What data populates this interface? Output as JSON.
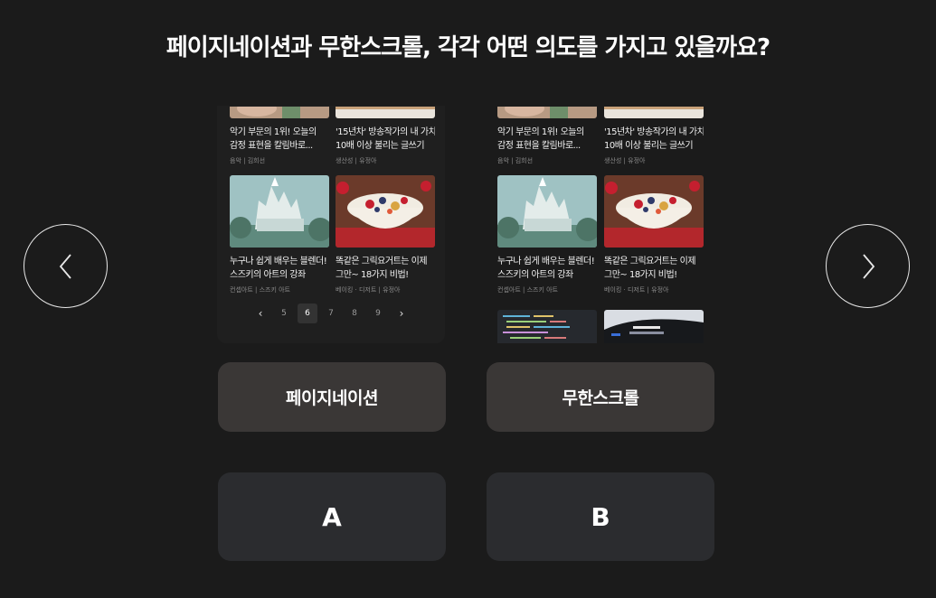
{
  "question": "페이지네이션과 무한스크롤, 각각 어떤 의도를 가지고 있을까요?",
  "navigation": {
    "prev_icon": "chevron-left-icon",
    "next_icon": "chevron-right-icon"
  },
  "cards": [
    {
      "title_line1": "악기 부문의 1위! 오늘의",
      "title_line2": "감정 표현을 칼림바로...",
      "meta": "음악 | 김희선"
    },
    {
      "title_line1": "'15년차' 방송작가의 내 가치",
      "title_line2": "10배 이상 불리는 글쓰기",
      "meta": "생산성 | 유정아"
    },
    {
      "title_line1": "누구나 쉽게 배우는 블렌더!",
      "title_line2": "스즈키의 아트의 강좌",
      "meta": "컨셉아트 | 스즈키 아트"
    },
    {
      "title_line1": "똑같은 그릭요거트는 이제",
      "title_line2": "그만~ 18가지 비법!",
      "meta": "베이킹 · 디저트 | 유정아"
    }
  ],
  "pagination": {
    "prev": "‹",
    "pages": [
      "5",
      "6",
      "7",
      "8",
      "9"
    ],
    "active_page": "6",
    "next": "›"
  },
  "options": {
    "left_label": "페이지네이션",
    "right_label": "무한스크롤"
  },
  "answers": {
    "a": "A",
    "b": "B"
  },
  "colors": {
    "background": "#1b1b1b",
    "label_button": "#3a3736",
    "choice_button": "#2b2c2f",
    "active_page": "#333333"
  }
}
